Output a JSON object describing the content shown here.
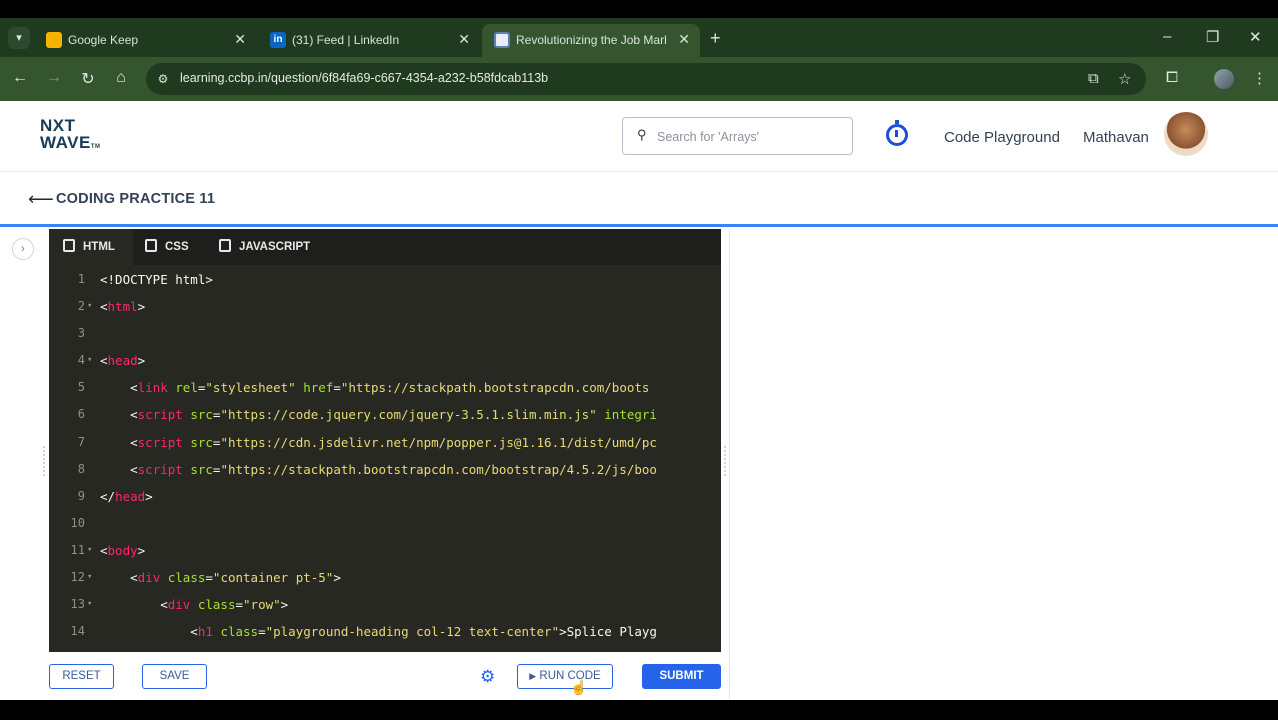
{
  "browser": {
    "tabs": [
      {
        "title": "Google Keep",
        "favicon": "keep-icon"
      },
      {
        "title": "(31) Feed | LinkedIn",
        "favicon": "linkedin-icon"
      },
      {
        "title": "Revolutionizing the Job Market",
        "favicon": "page-icon",
        "active": true
      }
    ],
    "url": "learning.ccbp.in/question/6f84fa69-c667-4354-a232-b58fdcab113b"
  },
  "header": {
    "logo_line1": "NXT",
    "logo_line2": "WAVE",
    "logo_tm": "TM",
    "search_placeholder": "Search for 'Arrays'",
    "code_playground": "Code Playground",
    "user_name": "Mathavan"
  },
  "subheader": {
    "title": "CODING PRACTICE 11"
  },
  "editor": {
    "tabs": [
      "HTML",
      "CSS",
      "JAVASCRIPT"
    ],
    "lines": [
      {
        "n": "1",
        "fold": false,
        "html": "&lt;!DOCTYPE html&gt;"
      },
      {
        "n": "2",
        "fold": true,
        "html": "&lt;<span class='tag'>html</span>&gt;"
      },
      {
        "n": "3",
        "fold": false,
        "html": ""
      },
      {
        "n": "4",
        "fold": true,
        "html": "&lt;<span class='tag'>head</span>&gt;"
      },
      {
        "n": "5",
        "fold": false,
        "html": "    &lt;<span class='tag'>link</span> <span class='attr'>rel</span>=<span class='str'>\"stylesheet\"</span> <span class='attr'>href</span>=<span class='str'>\"https://stackpath.bootstrapcdn.com/boots</span>"
      },
      {
        "n": "6",
        "fold": false,
        "html": "    &lt;<span class='tag'>script</span> <span class='attr'>src</span>=<span class='str'>\"https://code.jquery.com/jquery-3.5.1.slim.min.js\"</span> <span class='attr'>integri</span>"
      },
      {
        "n": "7",
        "fold": false,
        "html": "    &lt;<span class='tag'>script</span> <span class='attr'>src</span>=<span class='str'>\"https://cdn.jsdelivr.net/npm/popper.js@1.16.1/dist/umd/pc</span>"
      },
      {
        "n": "8",
        "fold": false,
        "html": "    &lt;<span class='tag'>script</span> <span class='attr'>src</span>=<span class='str'>\"https://stackpath.bootstrapcdn.com/bootstrap/4.5.2/js/boo</span>"
      },
      {
        "n": "9",
        "fold": false,
        "html": "&lt;/<span class='tag'>head</span>&gt;"
      },
      {
        "n": "10",
        "fold": false,
        "html": ""
      },
      {
        "n": "11",
        "fold": true,
        "html": "&lt;<span class='tag'>body</span>&gt;"
      },
      {
        "n": "12",
        "fold": true,
        "html": "    &lt;<span class='tag'>div</span> <span class='attr'>class</span>=<span class='str'>\"container pt-5\"</span>&gt;"
      },
      {
        "n": "13",
        "fold": true,
        "html": "        &lt;<span class='tag'>div</span> <span class='attr'>class</span>=<span class='str'>\"row\"</span>&gt;"
      },
      {
        "n": "14",
        "fold": false,
        "html": "            &lt;<span class='tag'>h1</span> <span class='attr'>class</span>=<span class='str'>\"playground-heading col-12 text-center\"</span>&gt;Splice Playg"
      }
    ]
  },
  "footer": {
    "reset": "RESET",
    "save": "SAVE",
    "run_code": "RUN CODE",
    "submit": "SUBMIT"
  },
  "colors": {
    "tag": "#f92672",
    "attr": "#a6e22e",
    "string": "#e6db74",
    "accent": "#2563eb"
  }
}
